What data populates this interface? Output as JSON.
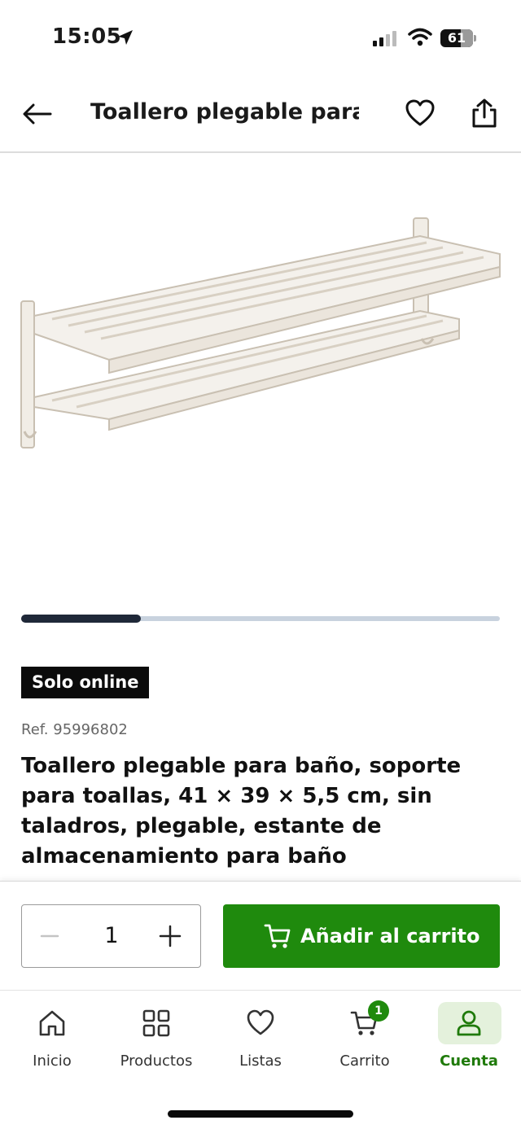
{
  "status_bar": {
    "time": "15:05",
    "battery": "61",
    "battery_level": 0.61
  },
  "header": {
    "title": "Toallero plegable para ...",
    "back_icon": "arrow-left-icon",
    "favorite_icon": "heart-icon",
    "share_icon": "share-icon"
  },
  "gallery": {
    "image_description_icon": "towel-rack-image",
    "progress": 0.25
  },
  "product": {
    "badge": "Solo online",
    "ref": "Ref. 95996802",
    "title": "Toallero plegable para baño, soporte para toallas, 41 × 39 × 5,5 cm, sin taladros, plegable, estante de almacenamiento para baño"
  },
  "cart_bar": {
    "quantity": "1",
    "add_to_cart_label": "Añadir al carrito",
    "accent_color": "#1f8a0d"
  },
  "tab_bar": {
    "tabs": [
      {
        "label": "Inicio",
        "icon": "home-icon"
      },
      {
        "label": "Productos",
        "icon": "grid-icon"
      },
      {
        "label": "Listas",
        "icon": "heart-icon"
      },
      {
        "label": "Carrito",
        "icon": "cart-icon",
        "badge": "1"
      },
      {
        "label": "Cuenta",
        "icon": "user-icon",
        "active": true
      }
    ]
  }
}
